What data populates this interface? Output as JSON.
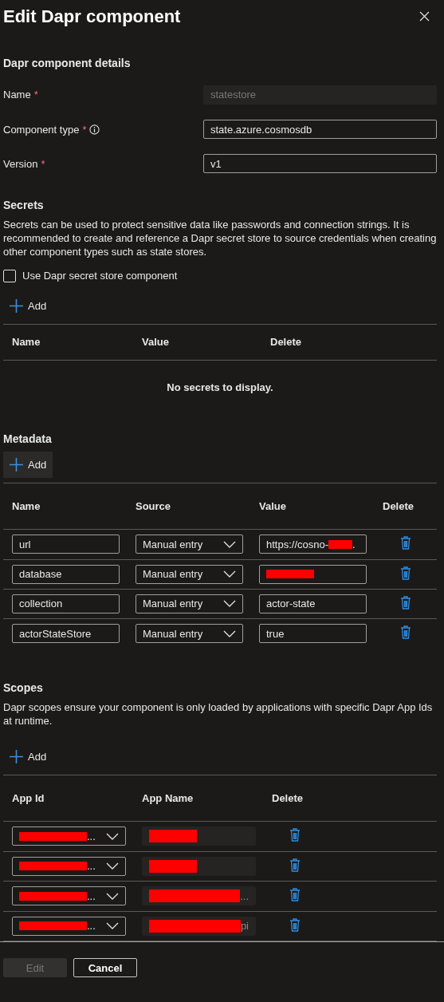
{
  "title": "Edit Dapr component",
  "details": {
    "heading": "Dapr component details",
    "fields": [
      {
        "label": "Name",
        "required_mark": "*",
        "info": false,
        "value": "statestore",
        "disabled": true
      },
      {
        "label": "Component type",
        "required_mark": "*",
        "info": true,
        "value": "state.azure.cosmosdb",
        "disabled": false
      },
      {
        "label": "Version",
        "required_mark": "*",
        "info": false,
        "value": "v1",
        "disabled": false
      }
    ]
  },
  "secrets": {
    "heading": "Secrets",
    "description": "Secrets can be used to protect sensitive data like passwords and connection strings. It is recommended to create and reference a Dapr secret store to source credentials when creating other component types such as state stores.",
    "checkbox": {
      "label": "Use Dapr secret store component",
      "checked": false
    },
    "add": "Add",
    "columns": [
      "Name",
      "Value",
      "Delete"
    ],
    "empty": "No secrets to display."
  },
  "metadata": {
    "heading": "Metadata",
    "add": "Add",
    "columns": [
      "Name",
      "Source",
      "Value",
      "Delete"
    ],
    "rows": [
      {
        "name": "url",
        "source": "Manual entry",
        "value": "https://cosno-",
        "redacted": true,
        "suffix": "."
      },
      {
        "name": "database",
        "source": "Manual entry",
        "redacted": true
      },
      {
        "name": "collection",
        "source": "Manual entry",
        "value": "actor-state",
        "redacted": false
      },
      {
        "name": "actorStateStore",
        "source": "Manual entry",
        "value": "true",
        "redacted": false
      }
    ]
  },
  "scopes": {
    "heading": "Scopes",
    "description": "Dapr scopes ensure your component is only loaded by applications with specific Dapr App Ids at runtime.",
    "add": "Add",
    "columns": [
      "App Id",
      "App Name",
      "Delete"
    ],
    "rows": [
      {
        "app_id": "...",
        "app_name_redacted": true
      },
      {
        "app_id": "...",
        "app_name_redacted": true
      },
      {
        "app_id": "...",
        "app_name": "...",
        "app_name_redacted": true
      },
      {
        "app_id": "...",
        "app_name": "pi",
        "app_name_redacted": true
      }
    ]
  },
  "footer": {
    "buttons": [
      {
        "label": "Edit",
        "disabled": true
      },
      {
        "label": "Cancel",
        "disabled": false
      }
    ]
  }
}
